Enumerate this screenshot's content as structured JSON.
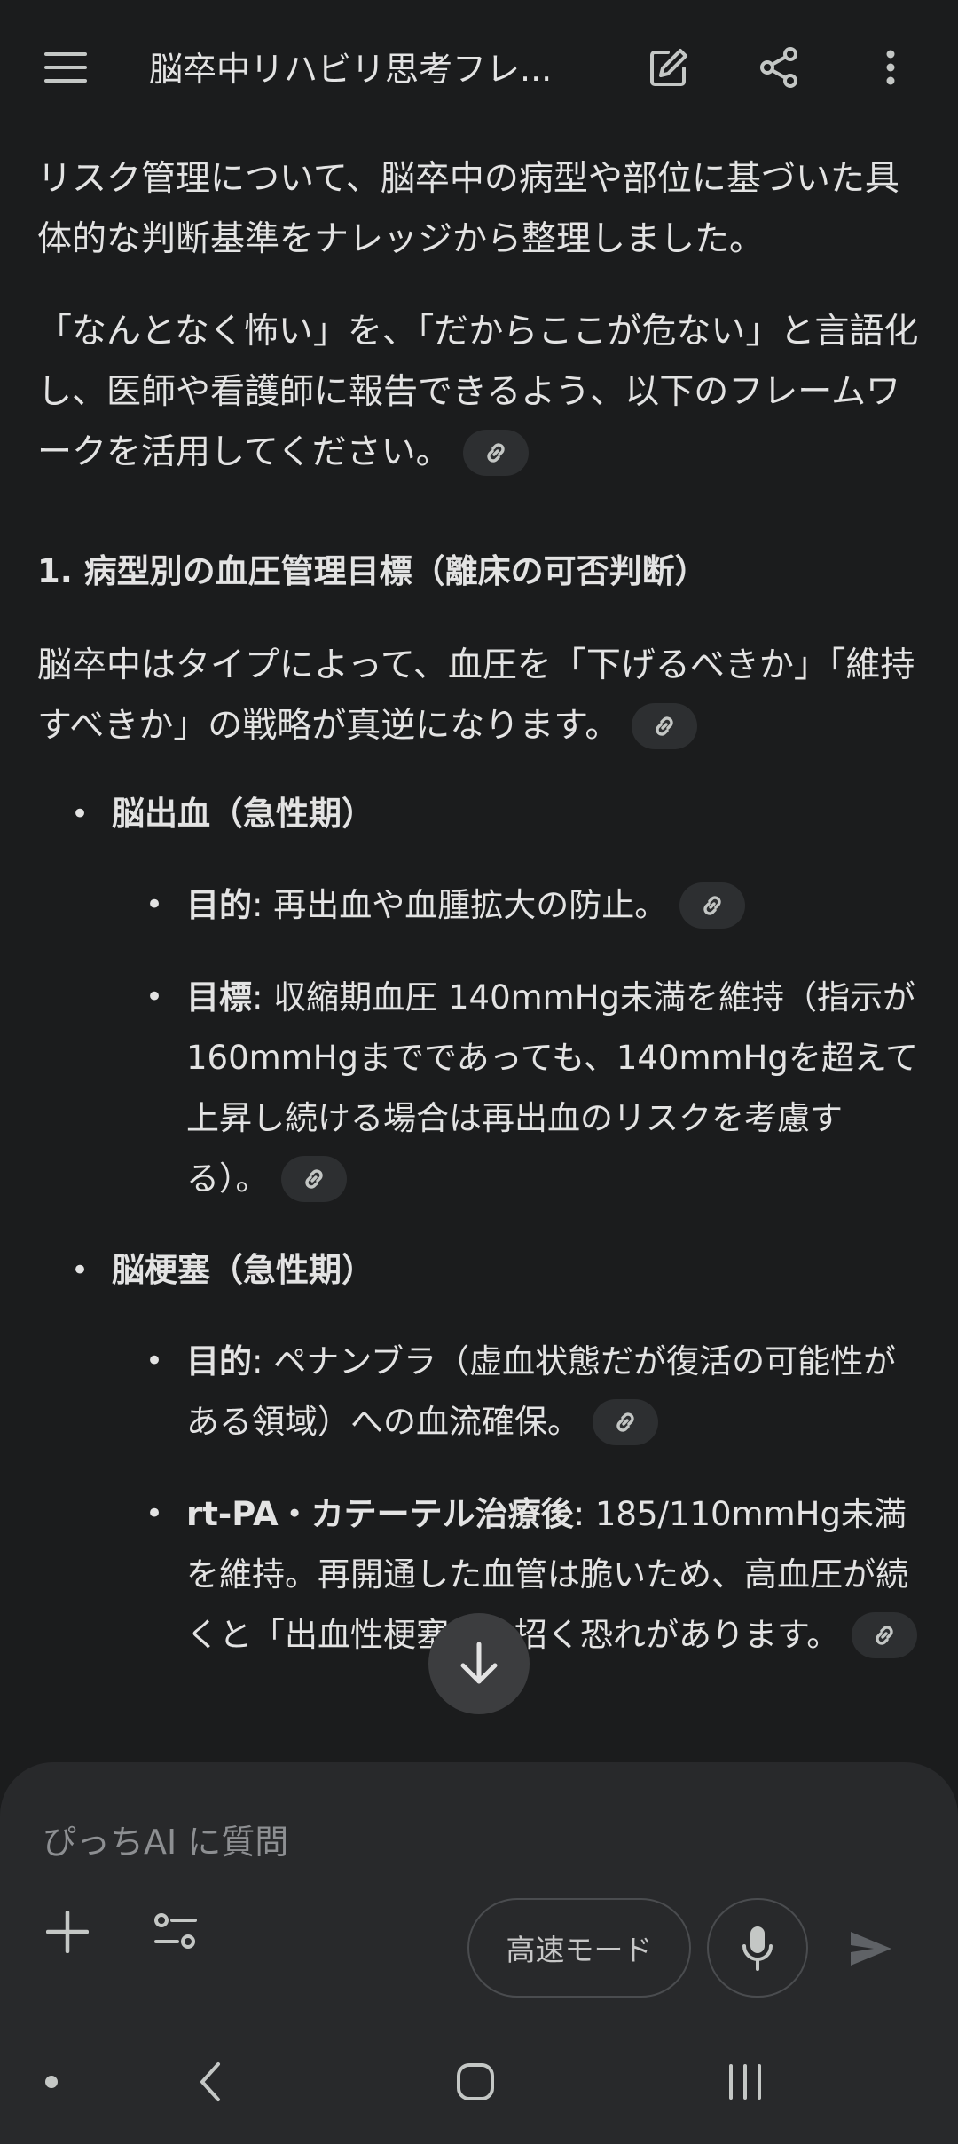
{
  "header": {
    "title": "脳卒中リハビリ思考フレ...",
    "menu_icon": "hamburger-menu-icon",
    "edit_icon": "edit-icon",
    "share_icon": "share-icon",
    "more_icon": "more-vert-icon"
  },
  "message": {
    "intro_1": "リスク管理について、脳卒中の病型や部位に基づいた具体的な判断基準をナレッジから整理しました。",
    "intro_2": "「なんとなく怖い」を、「だからここが危ない」と言語化し、医師や看護師に報告できるよう、以下のフレームワークを活用してください。",
    "section_1_heading": "1. 病型別の血圧管理目標（離床の可否判断）",
    "section_1_text": "脳卒中はタイプによって、血圧を「下げるべきか」「維持すべきか」の戦略が真逆になります。",
    "items": [
      {
        "title": "脳出血（急性期）",
        "subitems": [
          {
            "label": "目的",
            "text": ": 再出血や血腫拡大の防止。"
          },
          {
            "label": "目標",
            "text": ": 収縮期血圧 140mmHg未満を維持（指示が160mmHgまでであっても、140mmHgを超えて上昇し続ける場合は再出血のリスクを考慮する）。"
          }
        ]
      },
      {
        "title": "脳梗塞（急性期）",
        "subitems": [
          {
            "label": "目的",
            "text": ": ペナンブラ（虚血状態だが復活の可能性がある領域）への血流確保。"
          },
          {
            "label": "rt-PA・カテーテル治療後",
            "text": ": 185/110mmHg未満を維持。再開通した血管は脆いため、高血圧が続くと「出血性梗塞」を招く恐れがあります。"
          }
        ]
      }
    ],
    "source_chip_icon": "link-icon",
    "bullet": "•"
  },
  "scroll_button_icon": "arrow-down-icon",
  "composer": {
    "placeholder": "ぴっちAI に質問",
    "mode_label": "高速モード",
    "plus_icon": "plus-icon",
    "tools_icon": "tune-icon",
    "mic_icon": "mic-icon",
    "send_icon": "send-icon"
  },
  "system_nav": {
    "dot_icon": "nav-dot-icon",
    "back_icon": "nav-back-icon",
    "home_icon": "nav-home-icon",
    "recents_icon": "nav-recents-icon"
  },
  "colors": {
    "background": "#1b1c1d",
    "text": "#e3e3e3",
    "chip": "#2d2f31",
    "panel": "#28292b"
  }
}
